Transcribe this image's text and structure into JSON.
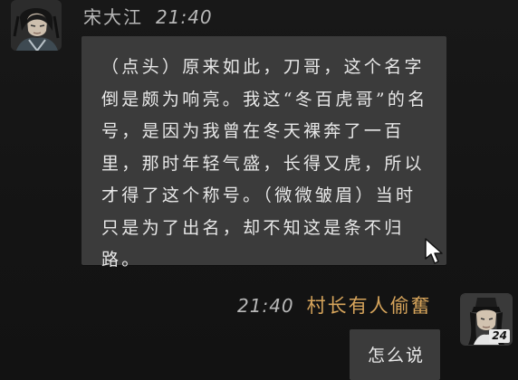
{
  "incoming_message": {
    "sender_name": "宋大江",
    "time": "21:40",
    "text": "（点头）原来如此，刀哥，这个名字倒是颇为响亮。我这“冬百虎哥”的名号，是因为我曾在冬天裸奔了一百里，那时年轻气盛，长得又虎，所以才得了这个称号。（微微皱眉）当时只是为了出名，却不知这是条不归路。",
    "avatar_icon": "character-portrait-icon"
  },
  "outgoing_message": {
    "sender_name": "村长有人偷奮",
    "time": "21:40",
    "text": "怎么说",
    "avatar_icon": "player-portrait-icon",
    "level_badge": "24"
  },
  "colors": {
    "background": "#151515",
    "bubble": "#3b3b3b",
    "player_name": "#d6a45b",
    "text": "#e8e8e8",
    "meta_text": "#b8b8b8"
  }
}
